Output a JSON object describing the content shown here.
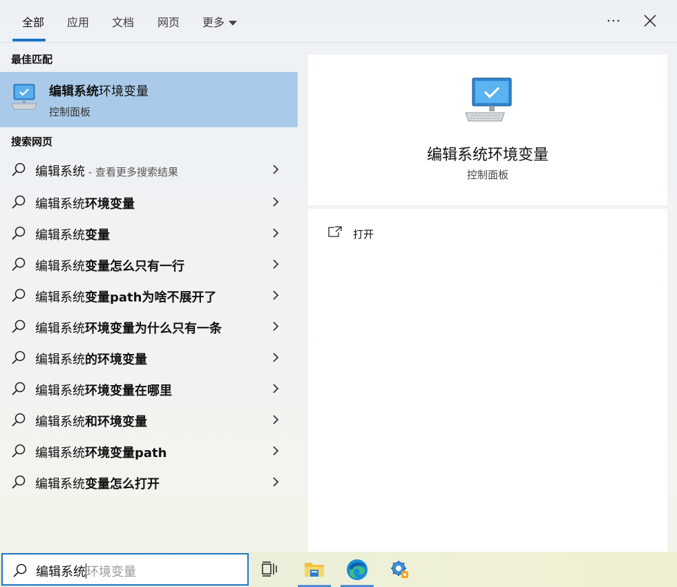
{
  "tabs": [
    {
      "label": "全部",
      "active": true
    },
    {
      "label": "应用"
    },
    {
      "label": "文档"
    },
    {
      "label": "网页"
    },
    {
      "label": "更多"
    }
  ],
  "header_icons": [
    "more-options-icon",
    "close-icon"
  ],
  "best_match": {
    "section_label": "最佳匹配",
    "title_bold": "编辑系统",
    "title_rest": "环境变量",
    "subtitle": "控制面板",
    "icon": "monitor-settings-icon"
  },
  "web_search": {
    "section_label": "搜索网页",
    "items": [
      {
        "prefix": "编辑系统",
        "bold": "",
        "hint": " - 查看更多搜索结果"
      },
      {
        "prefix": "编辑系统",
        "bold": "环境变量",
        "hint": ""
      },
      {
        "prefix": "编辑系统",
        "bold": "变量",
        "hint": ""
      },
      {
        "prefix": "编辑系统",
        "bold": "变量怎么只有一行",
        "hint": ""
      },
      {
        "prefix": "编辑系统",
        "bold": "变量path为啥不展开了",
        "hint": ""
      },
      {
        "prefix": "编辑系统",
        "bold": "环境变量为什么只有一条",
        "hint": ""
      },
      {
        "prefix": "编辑系统",
        "bold": "的环境变量",
        "hint": ""
      },
      {
        "prefix": "编辑系统",
        "bold": "环境变量在哪里",
        "hint": ""
      },
      {
        "prefix": "编辑系统",
        "bold": "和环境变量",
        "hint": ""
      },
      {
        "prefix": "编辑系统",
        "bold": "环境变量path",
        "hint": ""
      },
      {
        "prefix": "编辑系统",
        "bold": "变量怎么打开",
        "hint": ""
      }
    ]
  },
  "preview": {
    "title": "编辑系统环境变量",
    "subtitle": "控制面板",
    "action_label": "打开",
    "action_icon": "open-external-icon"
  },
  "search": {
    "typed": "编辑系统",
    "suggestion": "环境变量"
  },
  "taskbar": {
    "items": [
      "task-view-icon",
      "file-explorer-icon",
      "edge-browser-icon",
      "control-panel-icon"
    ]
  },
  "colors": {
    "accent": "#1a73c7",
    "best_match_bg": "#a9cbe9",
    "panel_bg": "#ffffff"
  }
}
